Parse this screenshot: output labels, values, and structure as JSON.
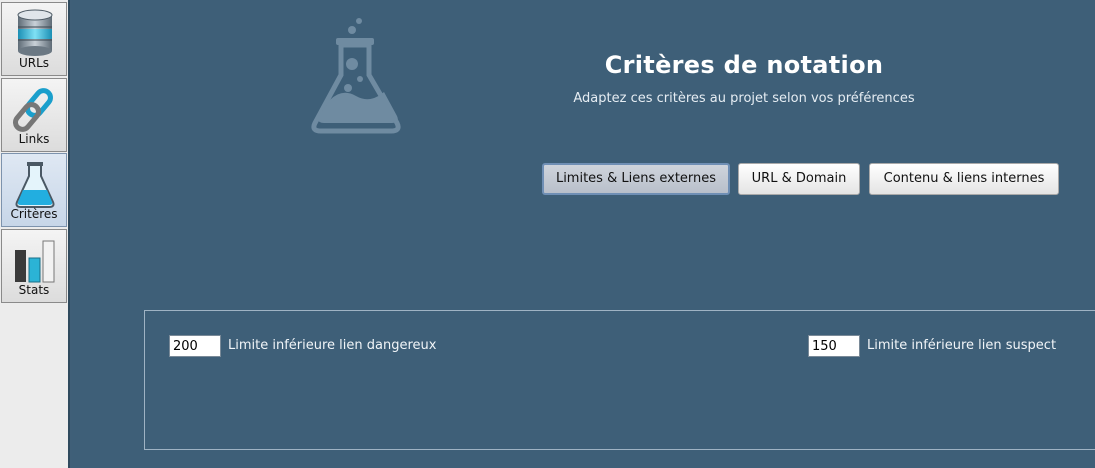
{
  "sidebar": {
    "items": [
      {
        "label": "URLs",
        "icon": "database-icon"
      },
      {
        "label": "Links",
        "icon": "chain-link-icon"
      },
      {
        "label": "Critères",
        "icon": "flask-icon",
        "active": true
      },
      {
        "label": "Stats",
        "icon": "bar-chart-icon"
      }
    ]
  },
  "header": {
    "title": "Critères de notation",
    "subtitle": "Adaptez ces critères au projet selon vos préférences",
    "icon": "flask-icon"
  },
  "tabs": [
    {
      "label": "Limites & Liens externes",
      "selected": true
    },
    {
      "label": "URL & Domain",
      "selected": false
    },
    {
      "label": "Contenu & liens internes",
      "selected": false
    }
  ],
  "fields": {
    "dangerous": {
      "value": "200",
      "label": "Limite inférieure lien dangereux"
    },
    "suspect": {
      "value": "150",
      "label": "Limite inférieure lien suspect"
    }
  },
  "colors": {
    "background": "#3e5f78",
    "sidebar": "#ececec",
    "accent": "#2bb3d6"
  }
}
